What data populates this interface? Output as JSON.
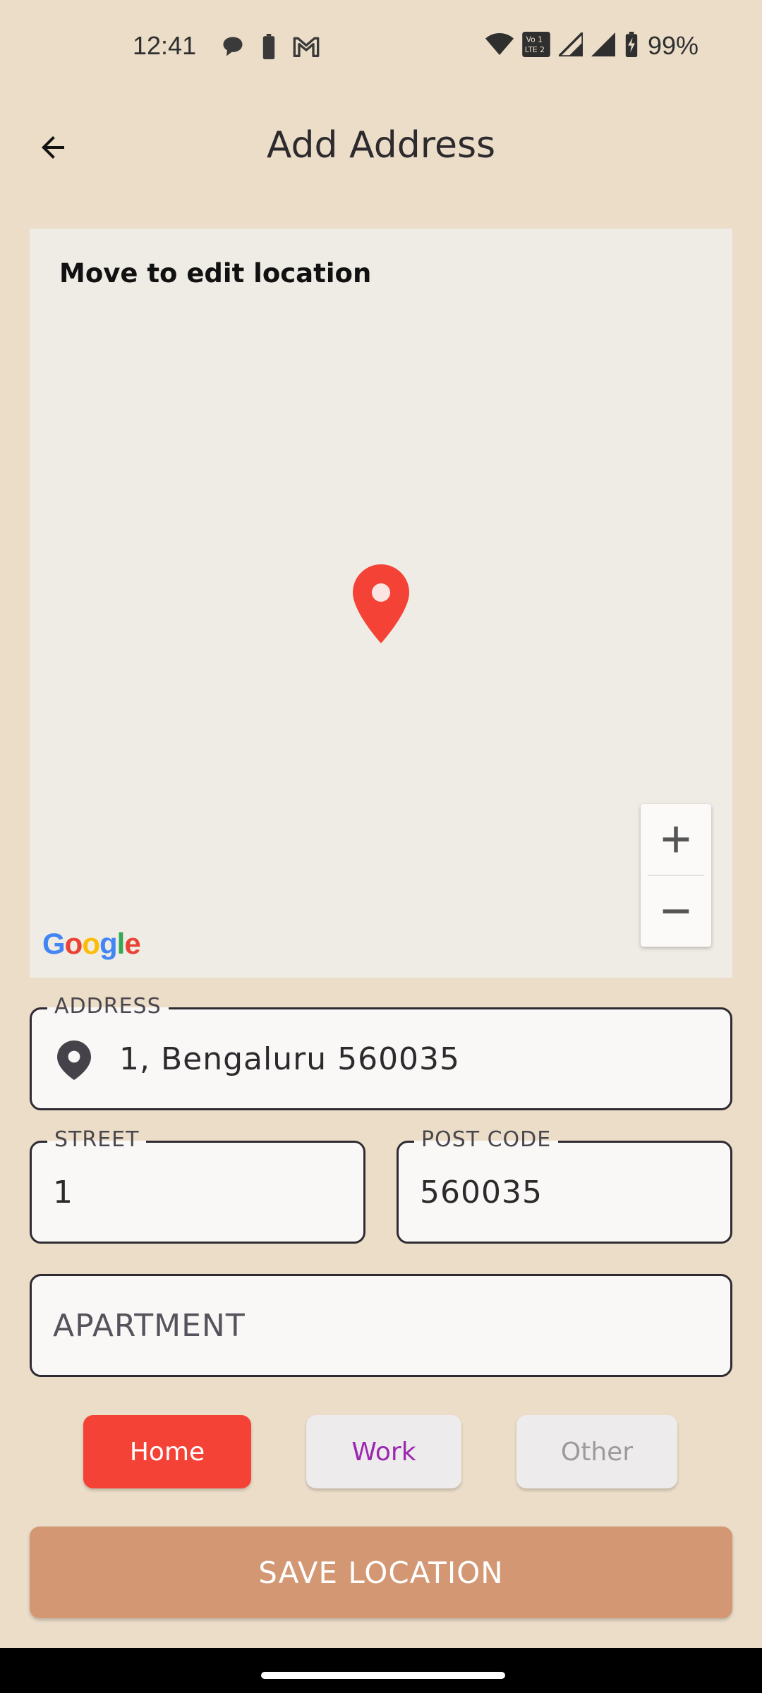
{
  "status_bar": {
    "time": "12:41",
    "battery_percent": "99%",
    "left_icons": [
      "chat-bubble-icon",
      "battery-icon",
      "gmail-icon"
    ],
    "right_icons": [
      "wifi-icon",
      "volte-icon",
      "signal-icon",
      "signal-icon",
      "battery-charging-icon"
    ]
  },
  "app_bar": {
    "title": "Add Address",
    "back_icon": "arrow-back-icon"
  },
  "map": {
    "hint": "Move to edit location",
    "zoom_in": "+",
    "zoom_out": "−",
    "attribution": "Google",
    "pin_color": "#F44336"
  },
  "form": {
    "address": {
      "label": "ADDRESS",
      "value": "1, Bengaluru 560035",
      "icon": "location-pin-icon"
    },
    "street": {
      "label": "STREET",
      "value": "1"
    },
    "post_code": {
      "label": "POST CODE",
      "value": "560035"
    },
    "apartment": {
      "placeholder": "APARTMENT"
    }
  },
  "address_types": {
    "home": "Home",
    "work": "Work",
    "other": "Other",
    "selected": "Home"
  },
  "save_button": "SAVE LOCATION",
  "colors": {
    "background": "#EBDDC8",
    "accent_home": "#F44336",
    "work_text": "#9C27B0",
    "save_button": "#D39873"
  }
}
